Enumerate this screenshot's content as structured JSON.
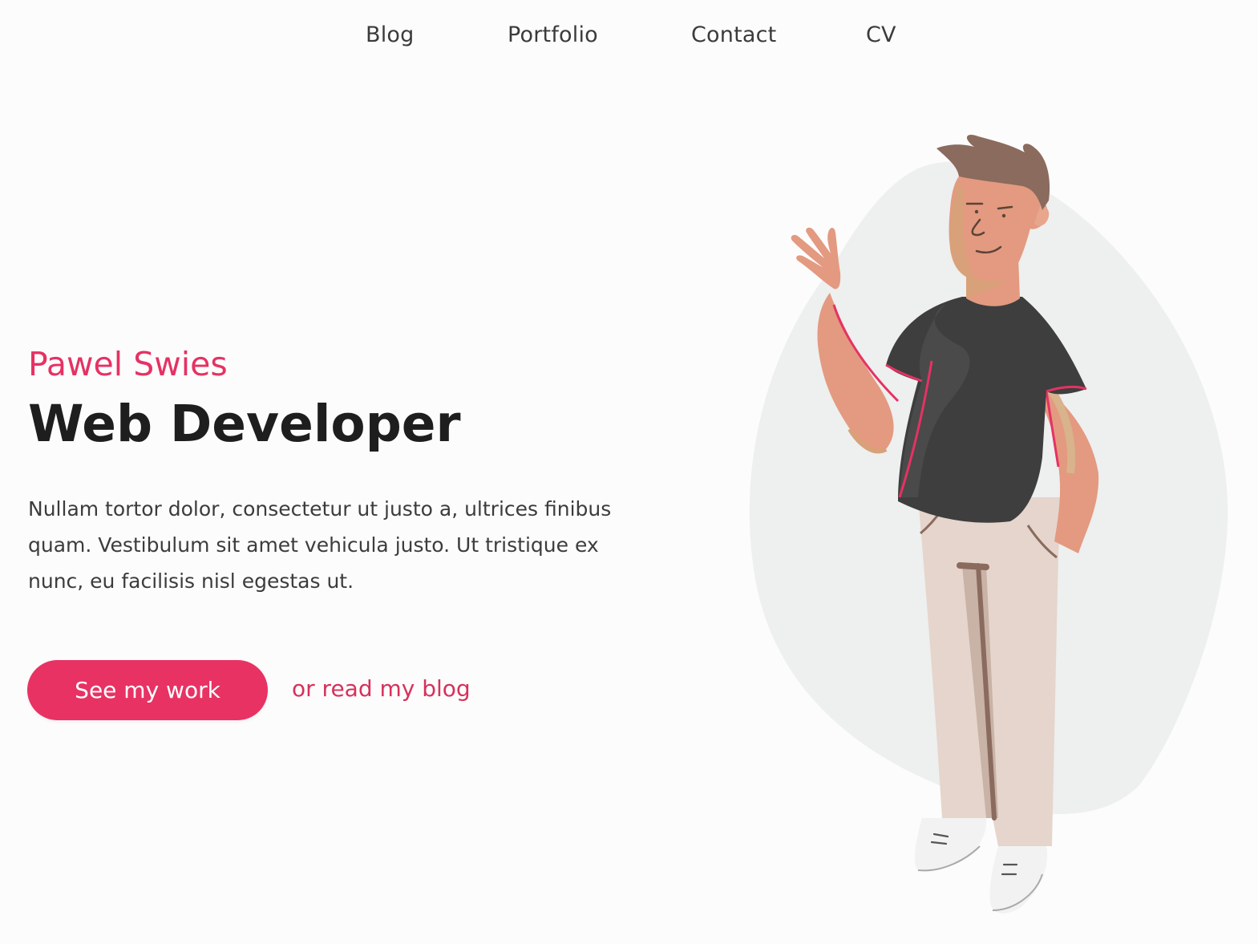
{
  "nav": {
    "items": [
      {
        "label": "Blog"
      },
      {
        "label": "Portfolio"
      },
      {
        "label": "Contact"
      },
      {
        "label": "CV"
      }
    ]
  },
  "hero": {
    "name": "Pawel Swies",
    "title": "Web Developer",
    "description": "Nullam tortor dolor, consectetur ut justo a, ultrices finibus quam. Vestibulum sit amet vehicula justo. Ut tristique ex nunc, eu facilisis nisl egestas ut.",
    "cta_label": "See my work",
    "secondary_link": "or read my blog"
  },
  "illustration": {
    "name": "person-waving-illustration"
  },
  "colors": {
    "accent": "#e83264",
    "title": "#1e1e1e",
    "text": "#3c3c3c",
    "blob": "#eeefef",
    "shirt": "#3e3e3e",
    "skin": "#e39a80",
    "hair": "#8a6b5e",
    "pants": "#e5d5cc"
  }
}
